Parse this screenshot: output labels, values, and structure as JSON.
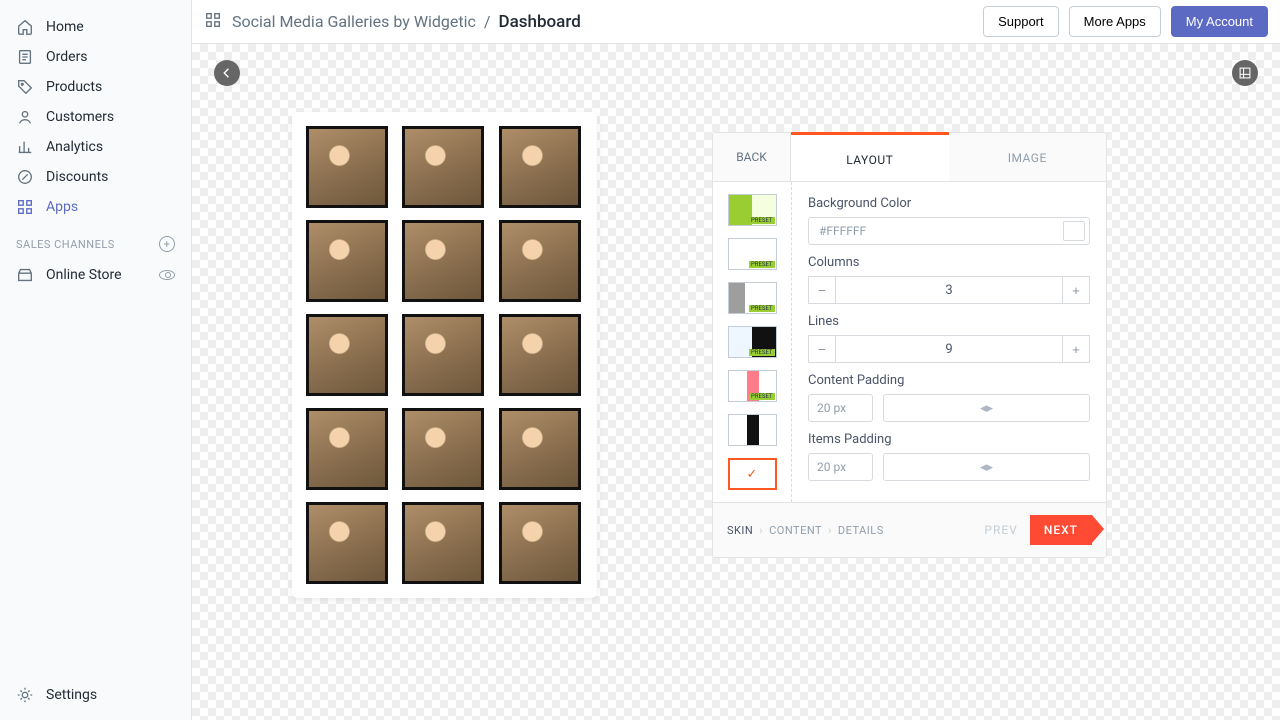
{
  "sidebar": {
    "items": [
      {
        "label": "Home"
      },
      {
        "label": "Orders"
      },
      {
        "label": "Products"
      },
      {
        "label": "Customers"
      },
      {
        "label": "Analytics"
      },
      {
        "label": "Discounts"
      },
      {
        "label": "Apps"
      }
    ],
    "section_label": "SALES CHANNELS",
    "channels": [
      {
        "label": "Online Store"
      }
    ],
    "settings_label": "Settings"
  },
  "breadcrumb": {
    "app": "Social Media Galleries by Widgetic",
    "sep": "/",
    "page": "Dashboard"
  },
  "topbar": {
    "support": "Support",
    "more_apps": "More Apps",
    "account": "My Account"
  },
  "panel": {
    "back": "BACK",
    "tabs": {
      "layout": "LAYOUT",
      "image": "IMAGE"
    },
    "fields": {
      "bg_label": "Background Color",
      "bg_value": "#FFFFFF",
      "columns_label": "Columns",
      "columns_value": "3",
      "lines_label": "Lines",
      "lines_value": "9",
      "content_padding_label": "Content Padding",
      "content_padding_value": "20 px",
      "items_padding_label": "Items Padding",
      "items_padding_value": "20 px"
    },
    "preset_label": "PRESET",
    "footer": {
      "skin": "SKIN",
      "content": "CONTENT",
      "details": "DETAILS",
      "prev": "PREV",
      "next": "NEXT"
    }
  }
}
